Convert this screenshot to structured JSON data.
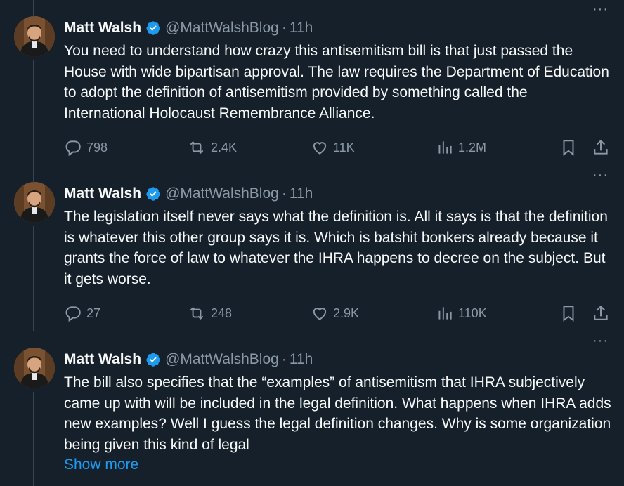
{
  "tweets": [
    {
      "name": "Matt Walsh",
      "handle": "@MattWalshBlog",
      "separator": "·",
      "time": "11h",
      "text": "You need to understand how crazy this antisemitism bill is that just passed the House with wide bipartisan approval. The law requires the Department of Education to adopt the definition of antisemitism provided by something called the International Holocaust Remembrance Alliance.",
      "replies": "798",
      "reposts": "2.4K",
      "likes": "11K",
      "views": "1.2M"
    },
    {
      "name": "Matt Walsh",
      "handle": "@MattWalshBlog",
      "separator": "·",
      "time": "11h",
      "text": "The legislation itself never says what the definition is. All it says is that the definition is whatever this other group says it is. Which is batshit bonkers already because it grants the force of law to whatever the IHRA happens to decree on the subject. But it gets worse.",
      "replies": "27",
      "reposts": "248",
      "likes": "2.9K",
      "views": "110K"
    },
    {
      "name": "Matt Walsh",
      "handle": "@MattWalshBlog",
      "separator": "·",
      "time": "11h",
      "text": "The bill also specifies that the “examples” of antisemitism that IHRA subjectively came up with will be included in the legal definition. What happens when IHRA adds new examples? Well I guess the legal definition changes. Why is some organization being given this kind of legal",
      "show_more": "Show more"
    }
  ],
  "more_label": "···",
  "colors": {
    "background": "#15202b",
    "text": "#f7f9f9",
    "secondary": "#8b98a5",
    "link": "#1d9bf0",
    "verified": "#1d9bf0"
  }
}
